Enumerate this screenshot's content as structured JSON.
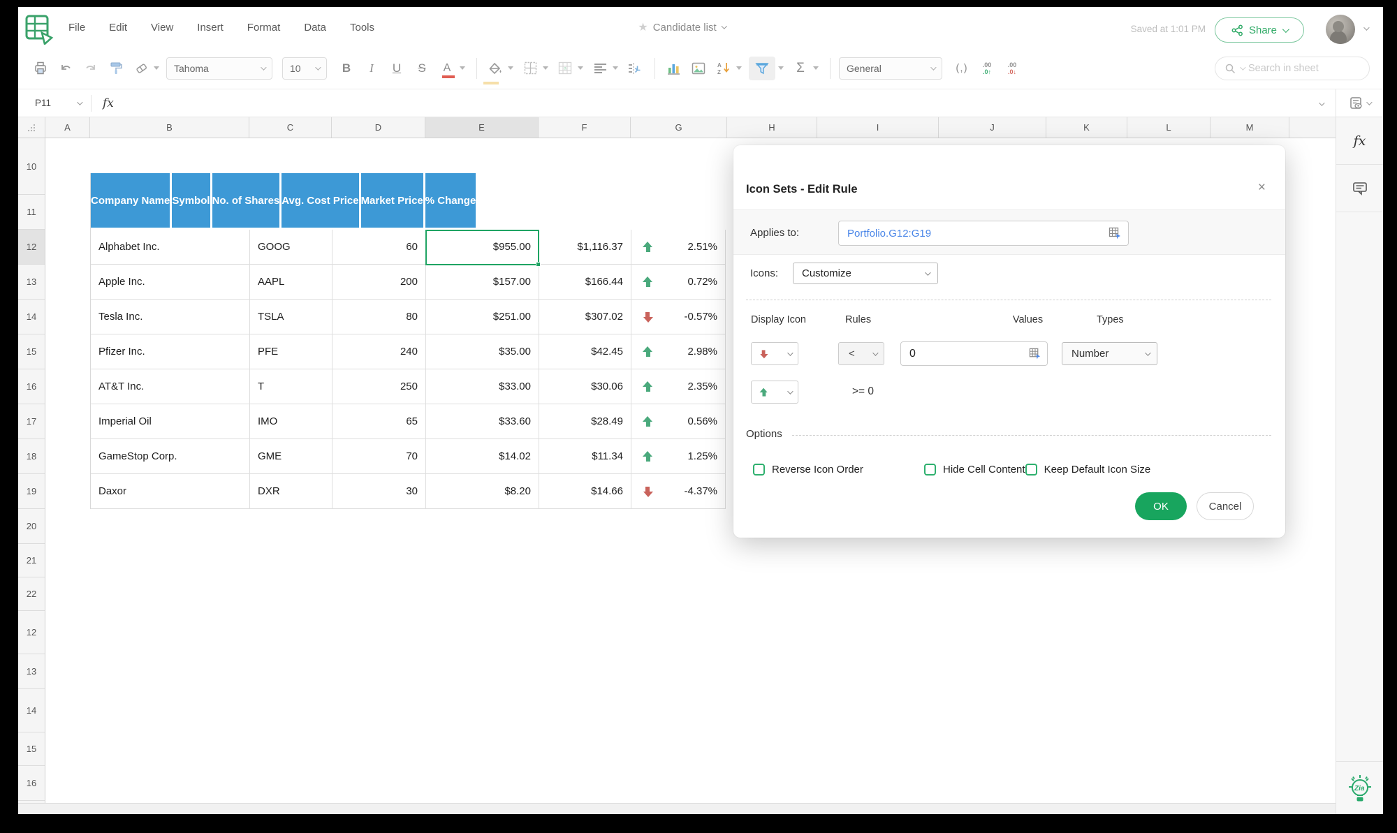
{
  "window": {
    "doc_title": "Candidate list",
    "saved_status": "Saved at 1:01 PM",
    "share_label": "Share"
  },
  "menubar": {
    "menus": [
      "File",
      "Edit",
      "View",
      "Insert",
      "Format",
      "Data",
      "Tools"
    ]
  },
  "toolbar": {
    "font_name": "Tahoma",
    "font_size": "10",
    "bold": "B",
    "italic": "I",
    "underline": "U",
    "strikethrough": "S",
    "font_color": "A",
    "sum": "Σ",
    "number_format": "General",
    "comma_format": "(,)",
    "decimal_digits": ".00",
    "decimal_up": ".0↑",
    "decimal_down": ".0↓",
    "search_placeholder": "Search in sheet"
  },
  "formula_bar": {
    "name_box": "P11",
    "fx_label": "fx"
  },
  "grid": {
    "column_headers": [
      "",
      "A",
      "B",
      "C",
      "D",
      "E",
      "F",
      "G",
      "H",
      "I",
      "J",
      "K",
      "L",
      "M",
      ""
    ],
    "row_headers": [
      "10",
      "11",
      "12",
      "13",
      "14",
      "15",
      "16",
      "17",
      "18",
      "19",
      "20",
      "21",
      "22",
      "12",
      "13",
      "14",
      "15",
      "16"
    ],
    "selected_cell_ref": "E12"
  },
  "table": {
    "headers": [
      "Company Name",
      "Symbol",
      "No. of Shares",
      "Avg. Cost Price",
      "Market Price",
      "% Change"
    ],
    "rows": [
      {
        "company": "Alphabet Inc.",
        "symbol": "GOOG",
        "shares": "60",
        "avg_cost": "$955.00",
        "market": "$1,116.37",
        "trend": "up",
        "change": "2.51%"
      },
      {
        "company": "Apple Inc.",
        "symbol": "AAPL",
        "shares": "200",
        "avg_cost": "$157.00",
        "market": "$166.44",
        "trend": "up",
        "change": "0.72%"
      },
      {
        "company": "Tesla Inc.",
        "symbol": "TSLA",
        "shares": "80",
        "avg_cost": "$251.00",
        "market": "$307.02",
        "trend": "down",
        "change": "-0.57%"
      },
      {
        "company": "Pfizer Inc.",
        "symbol": "PFE",
        "shares": "240",
        "avg_cost": "$35.00",
        "market": "$42.45",
        "trend": "up",
        "change": "2.98%"
      },
      {
        "company": "AT&T Inc.",
        "symbol": "T",
        "shares": "250",
        "avg_cost": "$33.00",
        "market": "$30.06",
        "trend": "up",
        "change": "2.35%"
      },
      {
        "company": "Imperial Oil",
        "symbol": "IMO",
        "shares": "65",
        "avg_cost": "$33.60",
        "market": "$28.49",
        "trend": "up",
        "change": "0.56%"
      },
      {
        "company": "GameStop Corp.",
        "symbol": "GME",
        "shares": "70",
        "avg_cost": "$14.02",
        "market": "$11.34",
        "trend": "up",
        "change": "1.25%"
      },
      {
        "company": "Daxor",
        "symbol": "DXR",
        "shares": "30",
        "avg_cost": "$8.20",
        "market": "$14.66",
        "trend": "down",
        "change": "-4.37%"
      }
    ]
  },
  "dialog": {
    "title": "Icon Sets - Edit Rule",
    "close": "×",
    "applies_to_label": "Applies to:",
    "applies_to_value": "Portfolio.G12:G19",
    "icons_label": "Icons:",
    "icons_value": "Customize",
    "col_display_icon": "Display Icon",
    "col_rules": "Rules",
    "col_values": "Values",
    "col_types": "Types",
    "rule1_operator": "<",
    "rule1_value": "0",
    "rule1_type": "Number",
    "rule2_text": ">= 0",
    "options_label": "Options",
    "options_checkboxes": [
      {
        "label": "Reverse Icon Order"
      },
      {
        "label": "Hide Cell Content"
      },
      {
        "label": "Keep Default Icon Size"
      }
    ],
    "ok_label": "OK",
    "cancel_label": "Cancel"
  },
  "colors": {
    "accent_green": "#21a55e",
    "table_header_blue": "#3d99d6",
    "trend_up_green": "#4aa97c",
    "trend_down_red": "#c9625b",
    "range_link_blue": "#4a86e8",
    "selection_green": "#1fa463"
  }
}
